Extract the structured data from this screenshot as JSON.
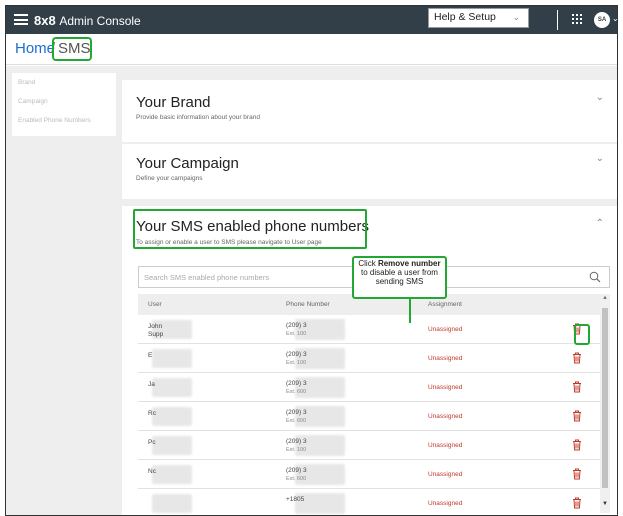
{
  "topbar": {
    "brand_bold": "8x8",
    "brand_name": "Admin Console",
    "help_label": "Help & Setup",
    "avatar_initials": "SA"
  },
  "breadcrumb": {
    "home": "Home",
    "separator": "/",
    "current": "SMS"
  },
  "sidenav": {
    "items": [
      "Brand",
      "Campaign",
      "Enabled Phone Numbers"
    ]
  },
  "brand_card": {
    "title": "Your Brand",
    "subtitle": "Provide basic information about your brand"
  },
  "campaign_card": {
    "title": "Your Campaign",
    "subtitle": "Define your campaigns"
  },
  "numbers_card": {
    "title": "Your SMS enabled phone numbers",
    "subtitle": "To assign or enable a user to SMS please navigate to User page",
    "search_placeholder": "Search SMS enabled phone numbers",
    "columns": [
      "User",
      "Phone Number",
      "Assignment"
    ],
    "rows": [
      {
        "user": "John",
        "user2": "Supp",
        "phone": "(209) 3",
        "ext": "Ext. 100",
        "assignment": "Unassigned"
      },
      {
        "user": "E",
        "user2": "",
        "phone": "(209) 3",
        "ext": "Ext. 100",
        "assignment": "Unassigned"
      },
      {
        "user": "Ja",
        "user2": "",
        "phone": "(209) 3",
        "ext": "Ext. 600",
        "assignment": "Unassigned"
      },
      {
        "user": "Rc",
        "user2": "",
        "phone": "(209) 3",
        "ext": "Ext. 600",
        "assignment": "Unassigned"
      },
      {
        "user": "Pc",
        "user2": "",
        "phone": "(209) 3",
        "ext": "Ext. 100",
        "assignment": "Unassigned"
      },
      {
        "user": "Nc",
        "user2": "",
        "phone": "(209) 3",
        "ext": "Ext. 600",
        "assignment": "Unassigned"
      },
      {
        "user": "",
        "user2": "",
        "phone": "+1805",
        "ext": "",
        "assignment": "Unassigned"
      }
    ]
  },
  "callout": {
    "prefix": "Click",
    "bold": "Remove number",
    "rest": "to disable a user from sending SMS"
  },
  "colors": {
    "topbar": "#333f48",
    "highlight": "#22a832",
    "unassigned": "#c0392b",
    "link": "#1a6fd0"
  },
  "icons": {
    "menu": "hamburger-icon",
    "apps": "grid-icon",
    "search": "search-icon",
    "remove": "trash-icon",
    "expand": "chevron-down-icon",
    "collapse": "chevron-up-icon"
  }
}
